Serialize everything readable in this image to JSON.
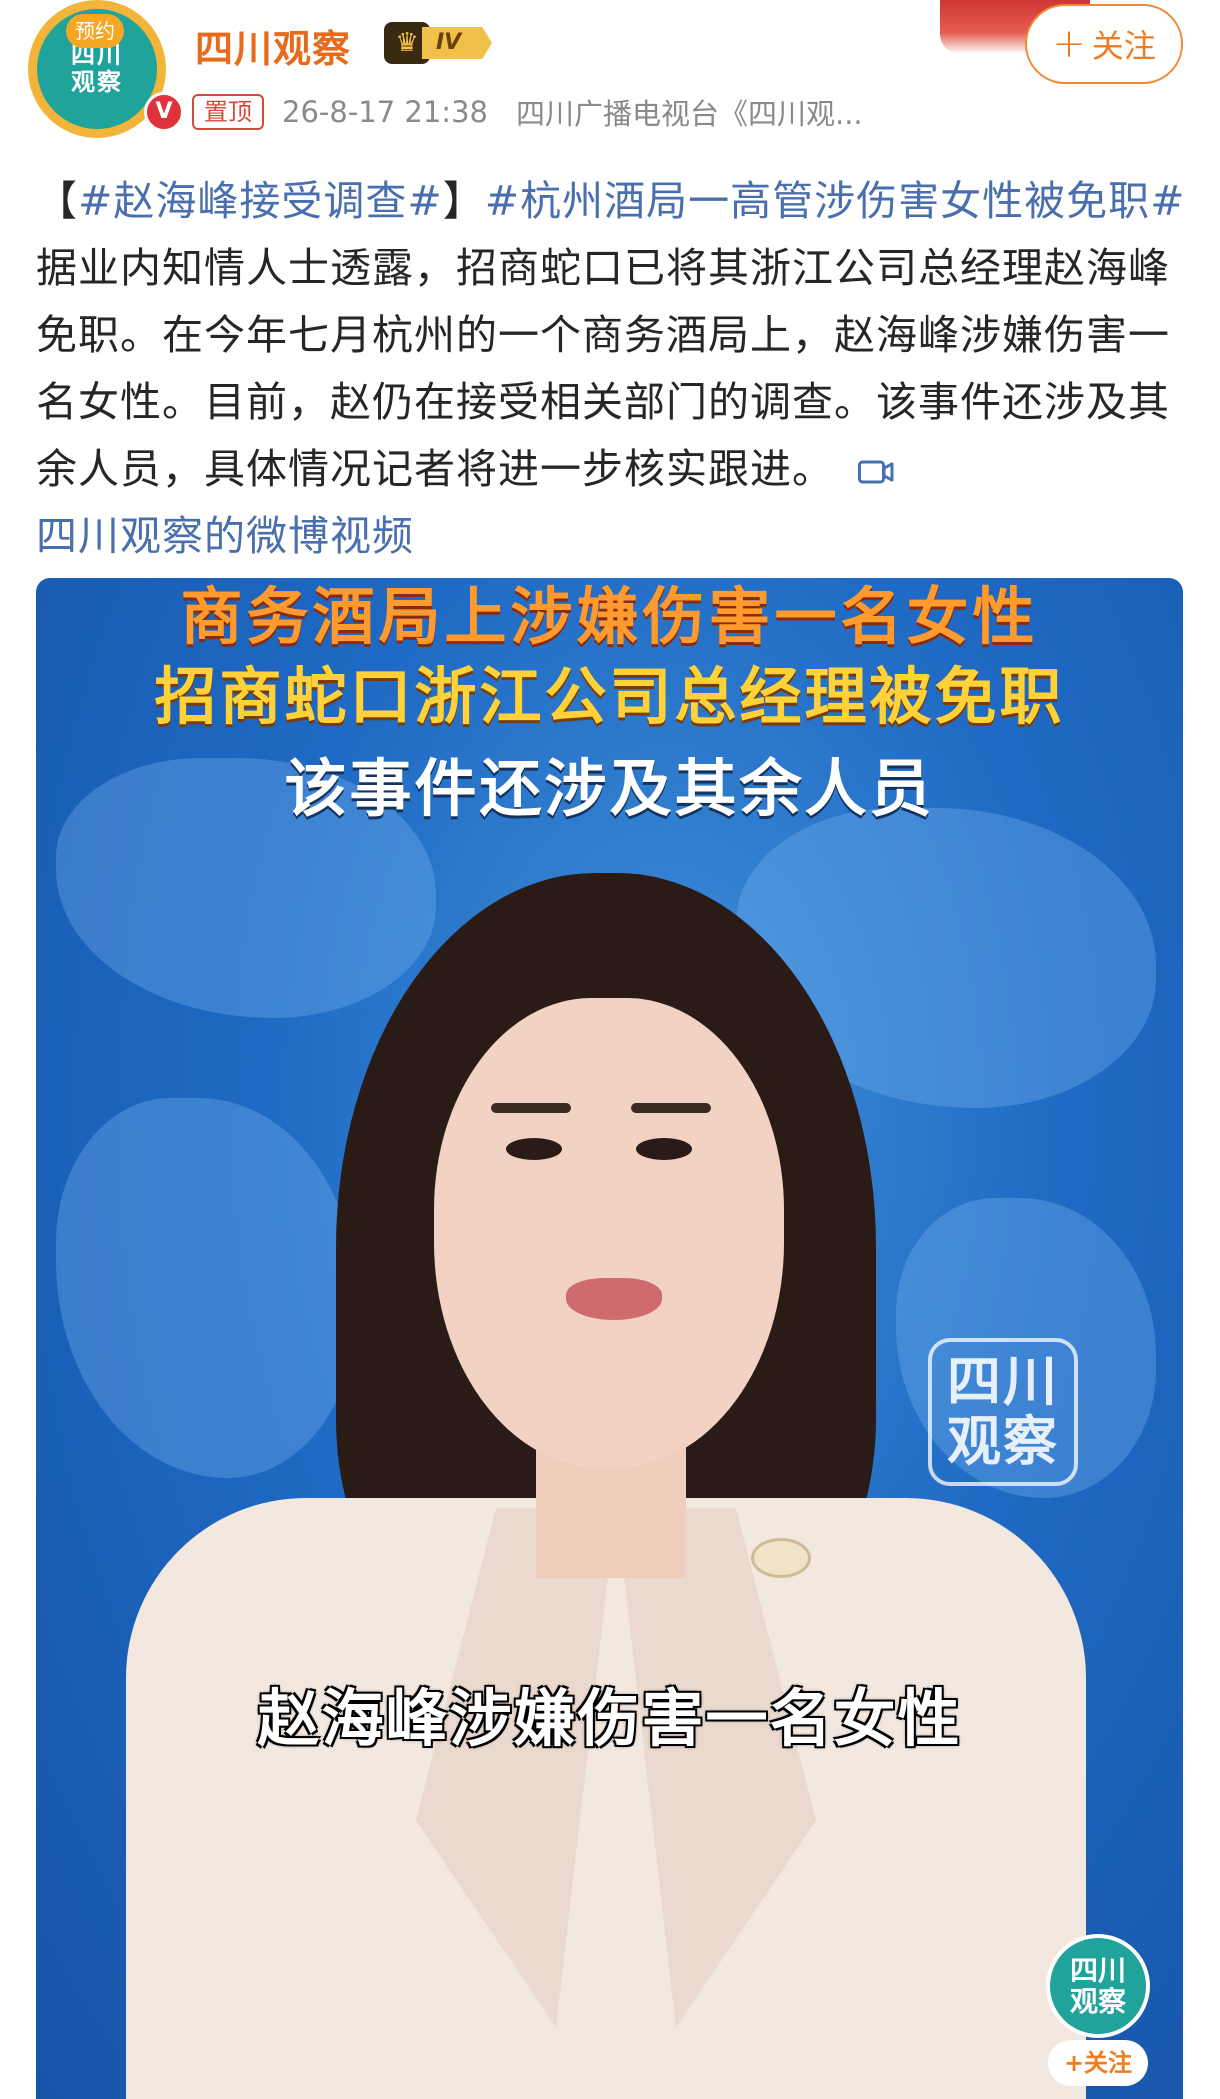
{
  "header": {
    "avatar_tag": "预约",
    "avatar_text_line1": "四川",
    "avatar_text_line2": "观察",
    "verified_mark": "V",
    "username": "四川观察",
    "level": "IV",
    "pin_label": "置顶",
    "time": "26-8-17 21:38",
    "source": "四川广播电视台《四川观...",
    "follow_label": "关注"
  },
  "post": {
    "bracket_open": "【",
    "hashtag_1": "#赵海峰接受调查#",
    "bracket_close": "】",
    "hashtag_2": "#杭州酒局一高管涉伤害女性被免职#",
    "body_text": "据业内知情人士透露，招商蛇口已将其浙江公司总经理赵海峰免职。在今年七月杭州的一个商务酒局上，赵海峰涉嫌伤害一名女性。目前，赵仍在接受相关部门的调查。该事件还涉及其余人员，具体情况记者将进一步核实跟进。",
    "video_link": "四川观察的微博视频"
  },
  "video": {
    "caption_1": "商务酒局上涉嫌伤害一名女性",
    "caption_2": "招商蛇口浙江公司总经理被免职",
    "caption_3": "该事件还涉及其余人员",
    "watermark_line1": "四川",
    "watermark_line2": "观察",
    "subtitle": "赵海峰涉嫌伤害一名女性",
    "mini_logo_line1": "四川",
    "mini_logo_line2": "观察",
    "mini_follow": "+关注"
  },
  "colors": {
    "accent_orange": "#ef7d1f",
    "hashtag_blue": "#4a6fae",
    "brand_teal": "#1fa39b",
    "pin_red": "#d24b3a"
  },
  "icons": [
    "verified-icon",
    "crown-icon",
    "video-icon",
    "plus-icon"
  ]
}
